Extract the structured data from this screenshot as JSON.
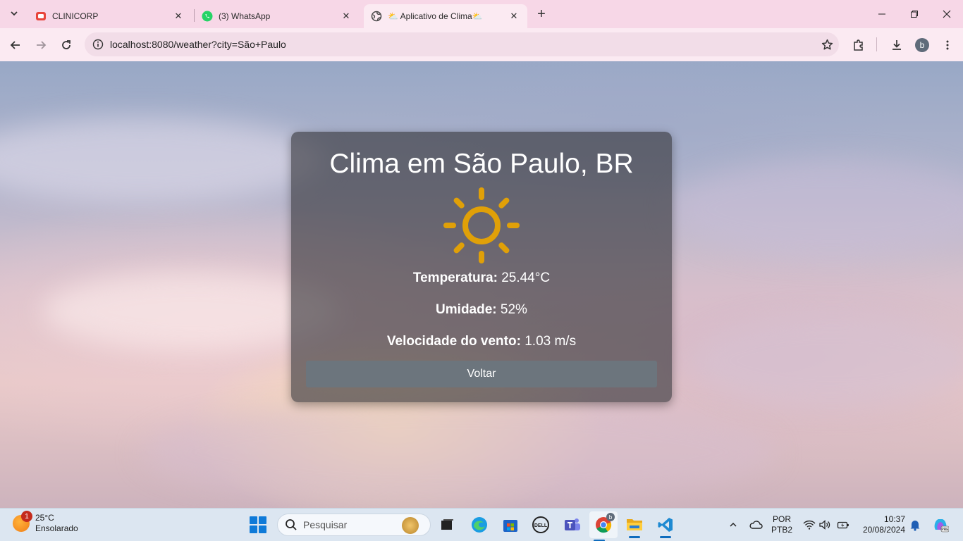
{
  "tabs": [
    {
      "title": "CLINICORP",
      "icon": "clinicorp-icon"
    },
    {
      "title": "(3) WhatsApp",
      "icon": "whatsapp-icon"
    },
    {
      "title": "⛅ Aplicativo de Clima⛅",
      "icon": "globe-icon"
    }
  ],
  "address_bar": {
    "url": "localhost:8080/weather?city=São+Paulo"
  },
  "weather_card": {
    "title": "Clima em São Paulo, BR",
    "temperature_label": "Temperatura:",
    "temperature_value": "25.44°C",
    "humidity_label": "Umidade:",
    "humidity_value": "52%",
    "wind_label": "Velocidade do vento:",
    "wind_value": "1.03 m/s",
    "back_button": "Voltar",
    "icon": "sun-icon",
    "icon_color": "#e0a008"
  },
  "taskbar": {
    "weather_temp": "25°C",
    "weather_desc": "Ensolarado",
    "weather_badge": "1",
    "search_placeholder": "Pesquisar",
    "language_line1": "POR",
    "language_line2": "PTB2",
    "time": "10:37",
    "date": "20/08/2024",
    "chrome_profile_badge": "b"
  },
  "profile": {
    "initial": "b"
  }
}
